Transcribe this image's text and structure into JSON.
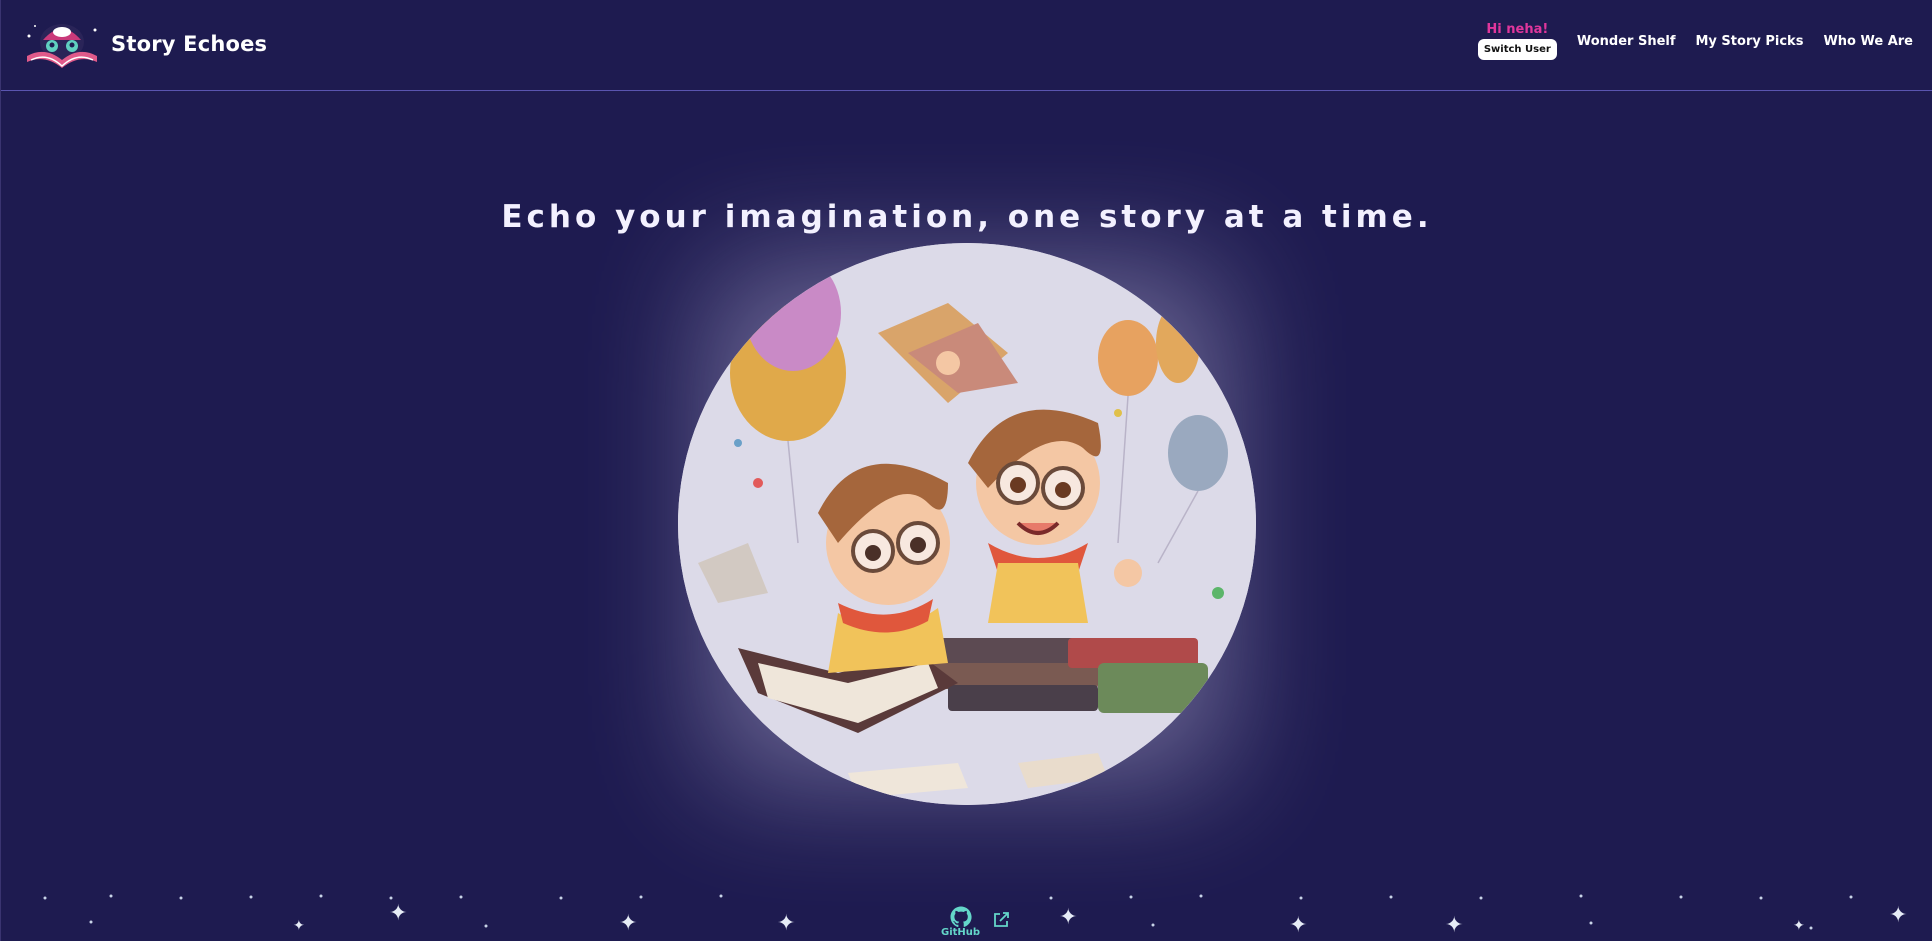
{
  "brand": {
    "name": "Story Echoes",
    "logo_icon": "open-book-reading-kids-logo"
  },
  "nav": {
    "greeting": "Hi neha!",
    "switch_user_label": "Switch User",
    "links": [
      {
        "label": "Wonder Shelf"
      },
      {
        "label": "My Story Picks"
      },
      {
        "label": "Who We Are"
      }
    ]
  },
  "hero": {
    "tagline": "Echo your imagination, one story at a time.",
    "image_description_icon": "kids-reading-books-balloons-illustration"
  },
  "footer": {
    "github_label": "GitHub",
    "github_icon": "github-icon",
    "external_icon": "external-link-icon"
  },
  "colors": {
    "background": "#1e1b50",
    "greeting": "#e0369c",
    "accent_teal": "#64d6c9",
    "header_border": "#5a55b0"
  }
}
